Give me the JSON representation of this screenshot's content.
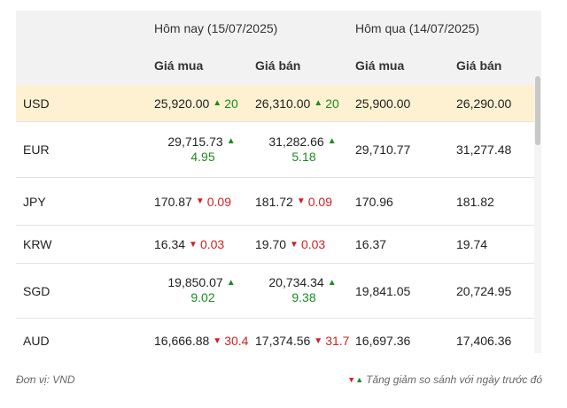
{
  "header": {
    "today_label": "Hôm nay (15/07/2025)",
    "yesterday_label": "Hôm qua (14/07/2025)",
    "buy_label": "Giá mua",
    "sell_label": "Giá bán"
  },
  "rows": [
    {
      "code": "USD",
      "today_buy": "25,920.00",
      "today_buy_chg": "20",
      "today_buy_dir": "up",
      "today_sell": "26,310.00",
      "today_sell_chg": "20",
      "today_sell_dir": "up",
      "yest_buy": "25,900.00",
      "yest_sell": "26,290.00"
    },
    {
      "code": "EUR",
      "today_buy": "29,715.73",
      "today_buy_chg": "4.95",
      "today_buy_dir": "up",
      "today_sell": "31,282.66",
      "today_sell_chg": "5.18",
      "today_sell_dir": "up",
      "yest_buy": "29,710.77",
      "yest_sell": "31,277.48"
    },
    {
      "code": "JPY",
      "today_buy": "170.87",
      "today_buy_chg": "0.09",
      "today_buy_dir": "down",
      "today_sell": "181.72",
      "today_sell_chg": "0.09",
      "today_sell_dir": "down",
      "yest_buy": "170.96",
      "yest_sell": "181.82"
    },
    {
      "code": "KRW",
      "today_buy": "16.34",
      "today_buy_chg": "0.03",
      "today_buy_dir": "down",
      "today_sell": "19.70",
      "today_sell_chg": "0.03",
      "today_sell_dir": "down",
      "yest_buy": "16.37",
      "yest_sell": "19.74"
    },
    {
      "code": "SGD",
      "today_buy": "19,850.07",
      "today_buy_chg": "9.02",
      "today_buy_dir": "up",
      "today_sell": "20,734.34",
      "today_sell_chg": "9.38",
      "today_sell_dir": "up",
      "yest_buy": "19,841.05",
      "yest_sell": "20,724.95"
    },
    {
      "code": "AUD",
      "today_buy": "16,666.88",
      "today_buy_chg": "30.4",
      "today_buy_dir": "down",
      "today_sell": "17,374.56",
      "today_sell_chg": "31.7",
      "today_sell_dir": "down",
      "yest_buy": "16,697.36",
      "yest_sell": "17,406.36"
    }
  ],
  "footer": {
    "unit": "Đơn vị: VND",
    "legend": "Tăng giảm so sánh với ngày trước đó"
  },
  "colors": {
    "up": "#1e8a1e",
    "down": "#d21f1f",
    "highlight_row": "#fdf1d1",
    "header_bg": "#f2f2f2"
  },
  "icons": {
    "up": "triangle-up-icon",
    "down": "triangle-down-icon"
  }
}
